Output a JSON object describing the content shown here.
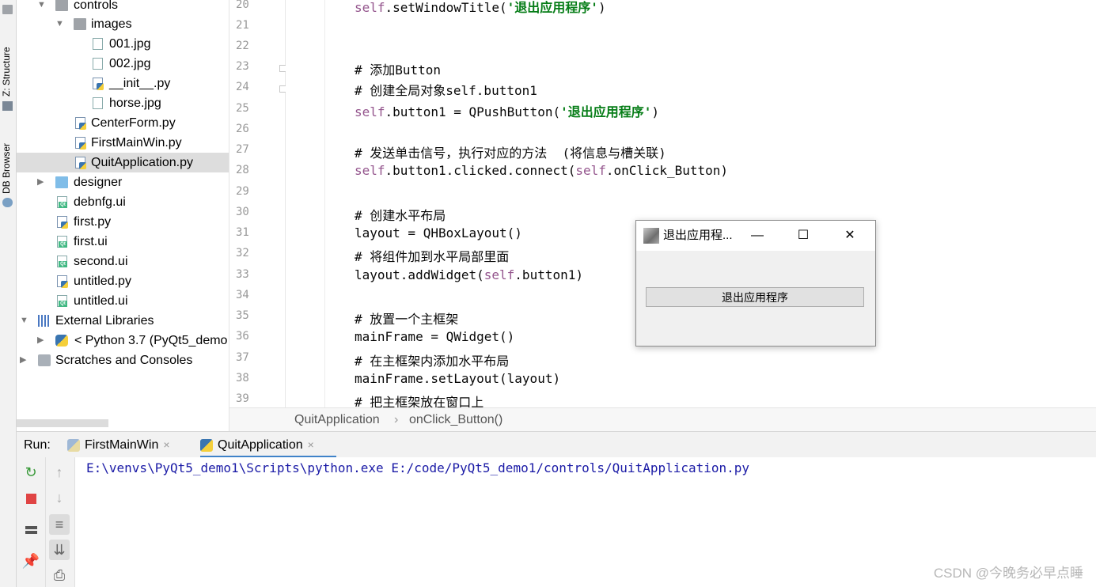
{
  "side_strip": {
    "structure_label": "Z: Structure",
    "db_browser_label": "DB Browser"
  },
  "project_tree": {
    "items": [
      {
        "label": "controls",
        "icon": "folder-icon"
      },
      {
        "label": "images",
        "icon": "folder-icon"
      },
      {
        "label": "001.jpg",
        "icon": "image-file-icon"
      },
      {
        "label": "002.jpg",
        "icon": "image-file-icon"
      },
      {
        "label": "__init__.py",
        "icon": "python-file-icon"
      },
      {
        "label": "horse.jpg",
        "icon": "image-file-icon"
      },
      {
        "label": "CenterForm.py",
        "icon": "python-file-icon"
      },
      {
        "label": "FirstMainWin.py",
        "icon": "python-file-icon"
      },
      {
        "label": "QuitApplication.py",
        "icon": "python-file-icon",
        "selected": true
      },
      {
        "label": "designer",
        "icon": "folder-icon"
      },
      {
        "label": "debnfg.ui",
        "icon": "qt-ui-file-icon"
      },
      {
        "label": "first.py",
        "icon": "python-file-icon"
      },
      {
        "label": "first.ui",
        "icon": "qt-ui-file-icon"
      },
      {
        "label": "second.ui",
        "icon": "qt-ui-file-icon"
      },
      {
        "label": "untitled.py",
        "icon": "python-file-icon"
      },
      {
        "label": "untitled.ui",
        "icon": "qt-ui-file-icon"
      },
      {
        "label": "External Libraries",
        "icon": "library-icon"
      },
      {
        "label": "< Python 3.7 (PyQt5_demo",
        "icon": "python-logo-icon"
      },
      {
        "label": "Scratches and Consoles",
        "icon": "scratches-icon"
      }
    ]
  },
  "editor": {
    "line_numbers": [
      "20",
      "21",
      "22",
      "23",
      "24",
      "25",
      "26",
      "27",
      "28",
      "29",
      "30",
      "31",
      "32",
      "33",
      "34",
      "35",
      "36",
      "37",
      "38",
      "39"
    ],
    "lines": {
      "l20_self": "self",
      "l20_rest": ".setWindowTitle(",
      "l20_str": "'退出应用程序'",
      "l20_end": ")",
      "l23": "# 添加Button",
      "l24": "# 创建全局对象self.button1",
      "l25_self": "self",
      "l25_rest": ".button1 = QPushButton(",
      "l25_str": "'退出应用程序'",
      "l25_end": ")",
      "l27": "# 发送单击信号，执行对应的方法  (将信息与槽关联)",
      "l28_self": "self",
      "l28_mid": ".button1.clicked.connect(",
      "l28_self2": "self",
      "l28_end": ".onClick_Button)",
      "l30": "# 创建水平布局",
      "l31": "layout = QHBoxLayout()",
      "l32": "# 将组件加到水平局部里面",
      "l33_a": "layout.addWidget(",
      "l33_self": "self",
      "l33_end": ".button1)",
      "l35": "# 放置一个主框架",
      "l36": "mainFrame = QWidget()",
      "l37": "# 在主框架内添加水平布局",
      "l38": "mainFrame.setLayout(layout)",
      "l39": "# 把主框架放在窗口上"
    }
  },
  "breadcrumb": {
    "class_name": "QuitApplication",
    "separator": "›",
    "method_name": "onClick_Button()"
  },
  "run_panel": {
    "label": "Run:",
    "tabs": [
      {
        "label": "FirstMainWin",
        "active": false
      },
      {
        "label": "QuitApplication",
        "active": true
      }
    ],
    "close_glyph": "×",
    "console_output": "E:\\venvs\\PyQt5_demo1\\Scripts\\python.exe E:/code/PyQt5_demo1/controls/QuitApplication.py"
  },
  "qt_window": {
    "title": "退出应用程...",
    "minimize_glyph": "—",
    "maximize_glyph": "☐",
    "close_glyph": "✕",
    "button_label": "退出应用程序"
  },
  "watermark": "CSDN @今晚务必早点睡",
  "colors": {
    "selection": "#dddddd",
    "keyword_self": "#94558d",
    "string": "#067d17",
    "comment": "#8c8c8c",
    "console_text": "#1a1aa6",
    "active_tab_underline": "#4083c9"
  }
}
